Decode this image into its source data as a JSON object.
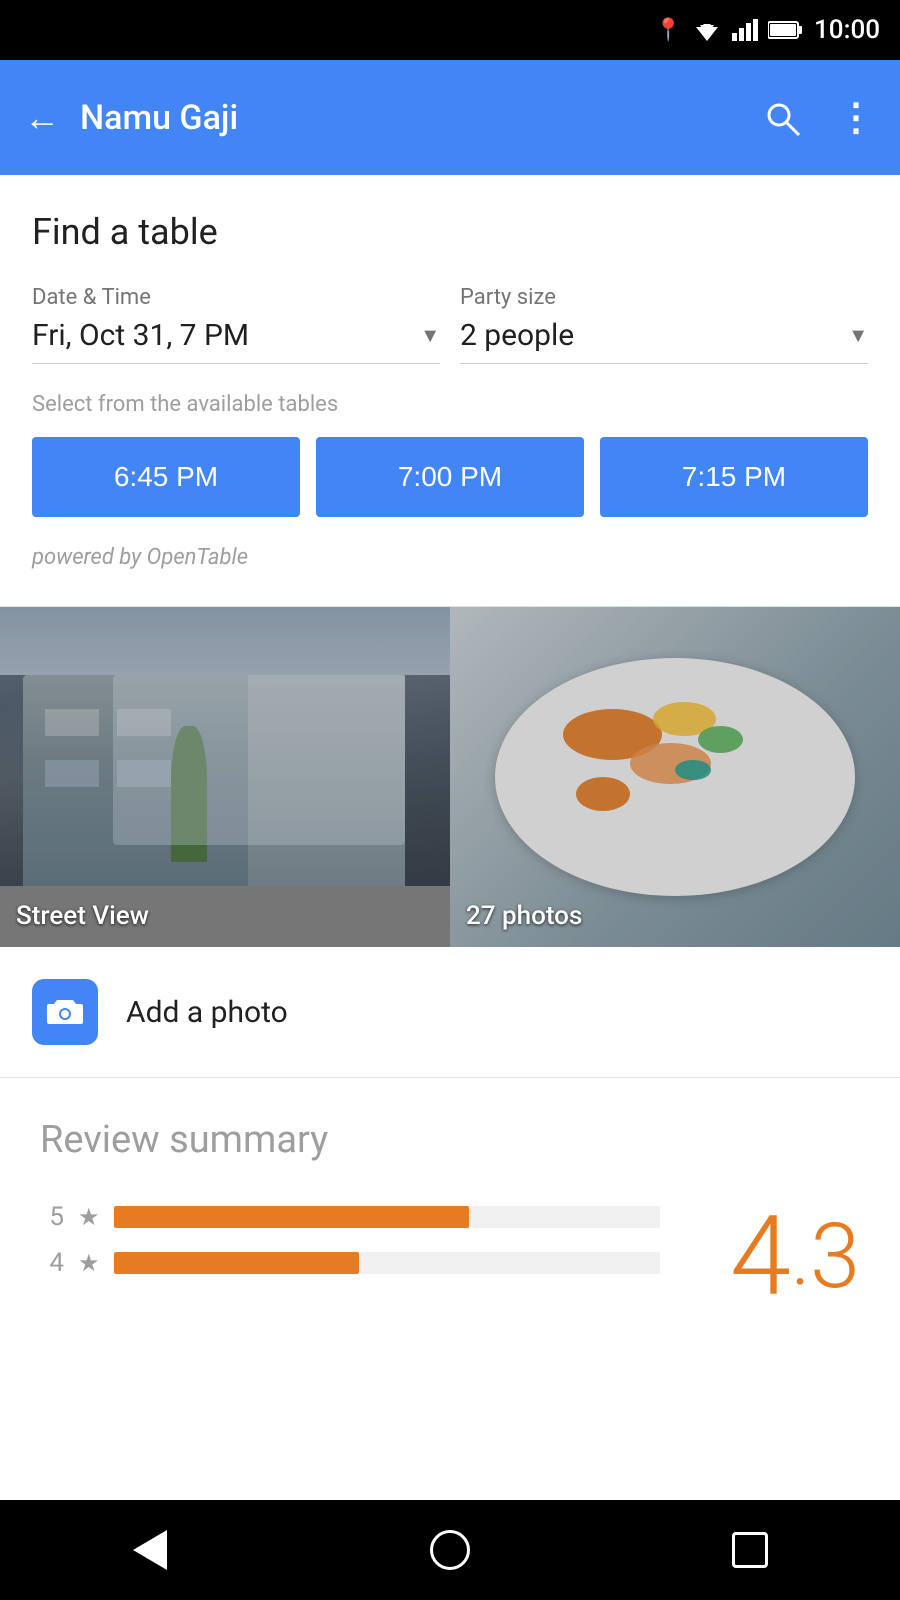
{
  "status_bar": {
    "time": "10:00"
  },
  "app_bar": {
    "back_label": "←",
    "title": "Namu Gaji",
    "search_label": "🔍",
    "more_label": "⋮"
  },
  "find_table": {
    "title": "Find a table",
    "date_time_label": "Date & Time",
    "date_time_value": "Fri, Oct 31, 7 PM",
    "party_size_label": "Party size",
    "party_size_value": "2 people",
    "available_label": "Select from the available tables",
    "time_slots": [
      "6:45 PM",
      "7:00 PM",
      "7:15 PM"
    ],
    "powered_by": "powered by OpenTable"
  },
  "photos": {
    "street_view_label": "Street View",
    "photos_label": "27 photos",
    "add_photo_label": "Add a photo"
  },
  "review_summary": {
    "title": "Review summary",
    "rating": "4",
    "rating_decimal": "3",
    "bars": [
      {
        "label": "5",
        "fill_percent": 65
      },
      {
        "label": "4",
        "fill_percent": 45
      }
    ]
  },
  "bottom_nav": {
    "back": "back",
    "home": "home",
    "recent": "recent"
  }
}
